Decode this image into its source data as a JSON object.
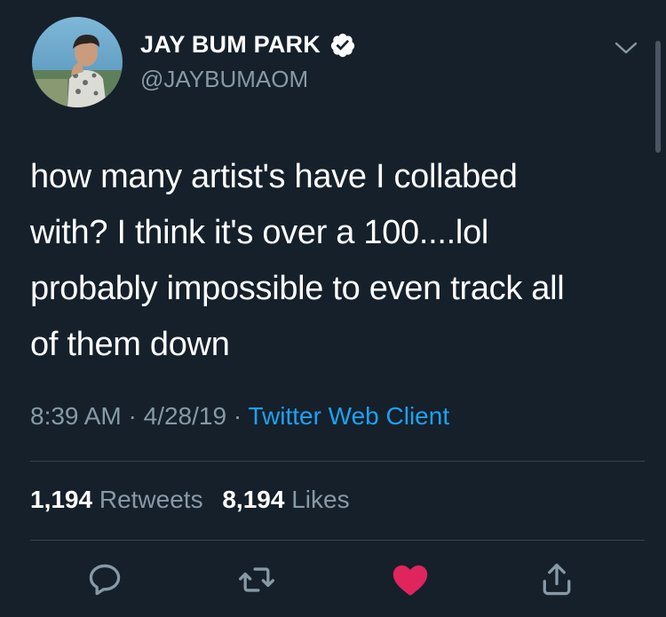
{
  "author": {
    "display_name": "JAY BUM PARK",
    "handle": "@JAYBUMAOM",
    "verified": true
  },
  "tweet": {
    "text_lines": [
      "how many artist's have I collabed",
      "with?  I think it's over a 100....lol",
      "probably impossible to even track all",
      "of them down"
    ]
  },
  "meta": {
    "time": "8:39 AM",
    "separator": " · ",
    "date": "4/28/19",
    "source": "Twitter Web Client"
  },
  "stats": {
    "retweets_count": "1,194",
    "retweets_label": "Retweets",
    "likes_count": "8,194",
    "likes_label": "Likes"
  },
  "actions": {
    "icons": [
      "reply-icon",
      "retweet-icon",
      "like-icon",
      "share-icon"
    ],
    "liked": true
  },
  "colors": {
    "background": "#15202b",
    "text_primary": "#ffffff",
    "text_secondary": "#8899a6",
    "link": "#1da1f2",
    "like": "#e0245e",
    "divider": "#38444d"
  }
}
